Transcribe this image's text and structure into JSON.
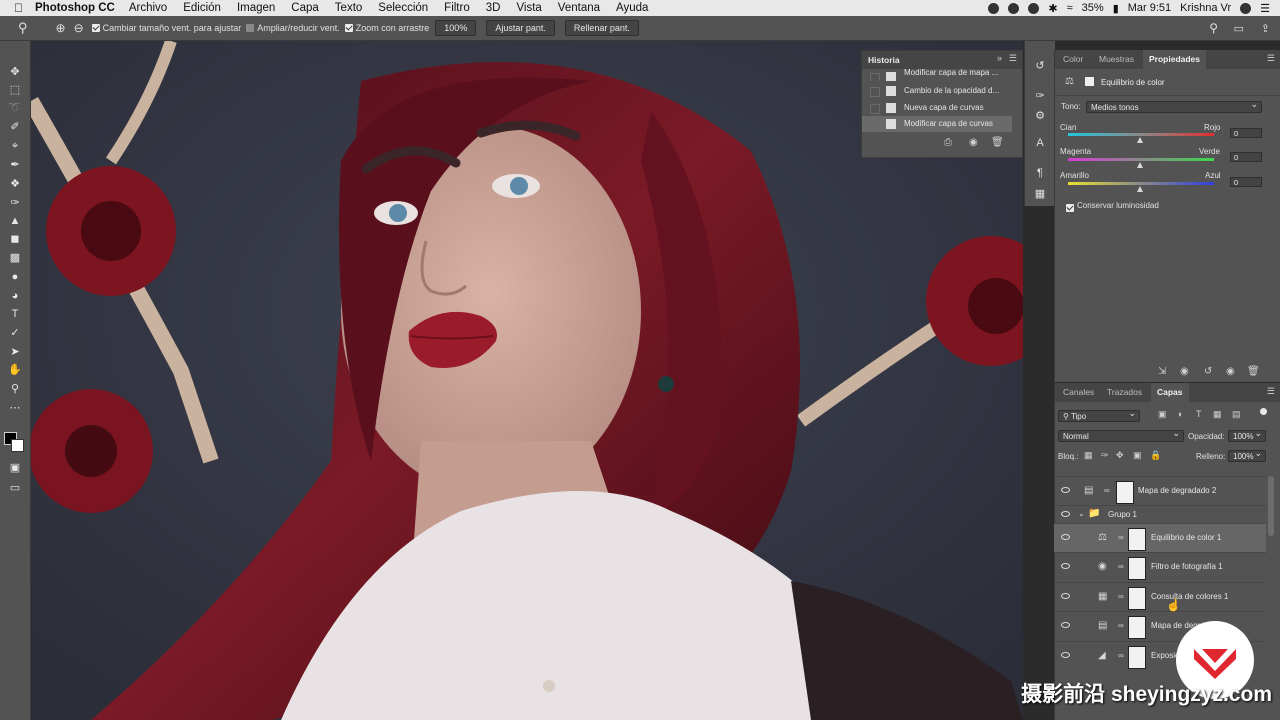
{
  "menubar": {
    "app": "Photoshop CC",
    "items": [
      "Archivo",
      "Edición",
      "Imagen",
      "Capa",
      "Texto",
      "Selección",
      "Filtro",
      "3D",
      "Vista",
      "Ventana",
      "Ayuda"
    ],
    "battery": "35%",
    "clock": "Mar 9:51",
    "user": "Krishna Vr"
  },
  "optbar": {
    "resize_label": "Cambiar tamaño vent. para ajustar",
    "zoom_all_label": "Ampliar/reducir vent.",
    "scrubby_label": "Zoom con arrastre",
    "zoom_value": "100%",
    "fit_button": "Ajustar pant.",
    "fill_button": "Rellenar pant."
  },
  "history": {
    "title": "Historia",
    "items": [
      "Modificar capa de mapa ...",
      "Cambio de la opacidad d...",
      "Nueva capa de curvas",
      "Modificar capa de curvas"
    ]
  },
  "properties": {
    "tabs": [
      "Color",
      "Muestras",
      "Propiedades"
    ],
    "adjustment": "Equilibrio de color",
    "tone_label": "Tono:",
    "tone_value": "Medios tonos",
    "sliders": [
      {
        "left": "Cian",
        "right": "Rojo",
        "value": "0"
      },
      {
        "left": "Magenta",
        "right": "Verde",
        "value": "0"
      },
      {
        "left": "Amarillo",
        "right": "Azul",
        "value": "0"
      }
    ],
    "preserve": "Conservar luminosidad"
  },
  "layers": {
    "tabs": [
      "Canales",
      "Trazados",
      "Capas"
    ],
    "filter": "Tipo",
    "blend": "Normal",
    "opacity_label": "Opacidad:",
    "opacity": "100%",
    "lock_label": "Bloq.:",
    "fill_label": "Relleno:",
    "fill": "100%",
    "rows": [
      {
        "name": "Mapa de degradado 2"
      },
      {
        "name": "Grupo 1"
      },
      {
        "name": "Equilibrio de color 1"
      },
      {
        "name": "Filtro de fotografía 1"
      },
      {
        "name": "Consulta de colores 1"
      },
      {
        "name": "Mapa de degr"
      },
      {
        "name": "Exposic"
      }
    ]
  },
  "watermark": "摄影前沿 sheyingzyz.com",
  "colors": {
    "panel": "#535353",
    "dark": "#3a3a3a",
    "lips": "#9a1c2a",
    "hair": "#6a1420"
  }
}
